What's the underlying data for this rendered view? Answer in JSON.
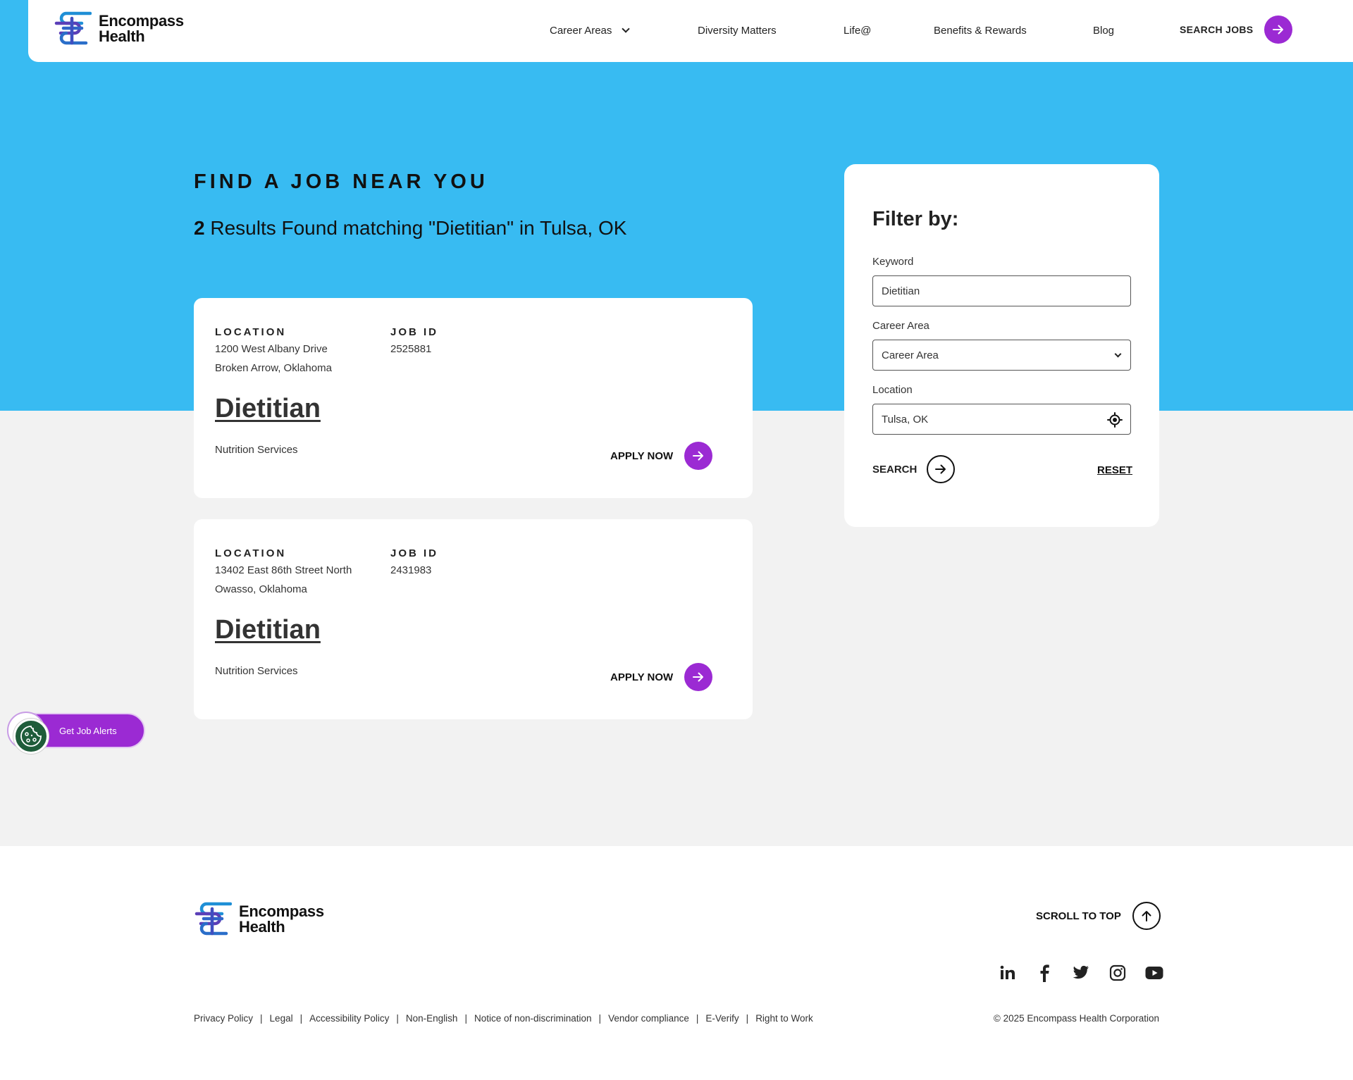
{
  "header": {
    "logo_line1": "Encompass",
    "logo_line2": "Health",
    "nav": [
      "Career Areas",
      "Diversity Matters",
      "Life@",
      "Benefits & Rewards",
      "Blog"
    ],
    "search_jobs_label": "SEARCH JOBS"
  },
  "hero": {
    "title": "FIND A JOB NEAR YOU",
    "results_count": "2",
    "results_text": " Results Found matching \"Dietitian\" in Tulsa, OK"
  },
  "jobs": [
    {
      "location_label": "LOCATION",
      "address_line1": "1200 West Albany Drive",
      "address_line2": "Broken Arrow, Oklahoma",
      "job_id_label": "JOB ID",
      "job_id": "2525881",
      "title": "Dietitian",
      "department": "Nutrition Services",
      "apply_label": "APPLY NOW"
    },
    {
      "location_label": "LOCATION",
      "address_line1": "13402 East 86th Street North",
      "address_line2": "Owasso, Oklahoma",
      "job_id_label": "JOB ID",
      "job_id": "2431983",
      "title": "Dietitian",
      "department": "Nutrition Services",
      "apply_label": "APPLY NOW"
    }
  ],
  "filter": {
    "heading": "Filter by:",
    "keyword_label": "Keyword",
    "keyword_value": "Dietitian",
    "career_area_label": "Career Area",
    "career_area_value": "Career Area",
    "location_label": "Location",
    "location_value": "Tulsa, OK",
    "search_label": "SEARCH",
    "reset_label": "RESET"
  },
  "job_alerts": {
    "label": "Get Job Alerts"
  },
  "footer": {
    "logo_line1": "Encompass",
    "logo_line2": "Health",
    "scroll_top_label": "SCROLL TO TOP",
    "social_icons": [
      "linkedin-icon",
      "facebook-icon",
      "twitter-icon",
      "instagram-icon",
      "youtube-icon"
    ],
    "links": [
      "Privacy Policy",
      "Legal",
      "Accessibility Policy",
      "Non-English",
      "Notice of non-discrimination",
      "Vendor compliance",
      "E-Verify",
      "Right to Work"
    ],
    "copyright": "© 2025 Encompass Health Corporation"
  },
  "colors": {
    "hero_blue": "#38bbf2",
    "accent_purple": "#9b2ad3",
    "background_gray": "#f2f2f2",
    "cookie_green": "#1f5c3a"
  }
}
